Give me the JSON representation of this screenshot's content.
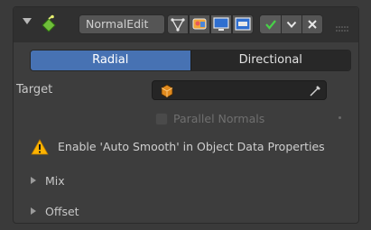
{
  "header": {
    "modifier_name": "NormalEdit",
    "icons": [
      "collapse-arrow-icon",
      "normal-edit-modifier-icon",
      "edit-mode-icon",
      "on-cage-icon",
      "realtime-icon",
      "render-icon",
      "apply-icon",
      "dropdown-icon",
      "remove-icon",
      "drag-handle-icon"
    ]
  },
  "mode_tabs": [
    {
      "label": "Radial",
      "active": true
    },
    {
      "label": "Directional",
      "active": false
    }
  ],
  "target": {
    "label": "Target",
    "value": ""
  },
  "parallel_normals": {
    "label": "Parallel Normals",
    "checked": false
  },
  "warning": {
    "text": "Enable 'Auto Smooth' in Object Data Properties"
  },
  "subpanels": [
    {
      "label": "Mix"
    },
    {
      "label": "Offset"
    }
  ],
  "colors": {
    "accent": "#4772b3",
    "warning": "#ffb400",
    "ok_green": "#3fa23f",
    "object_orange": "#e08a1e"
  }
}
